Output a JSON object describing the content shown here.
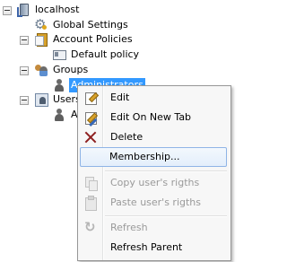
{
  "tree": {
    "root": "localhost",
    "global_settings": "Global Settings",
    "account_policies": "Account Policies",
    "default_policy": "Default policy",
    "groups": "Groups",
    "administrators": "Administrators",
    "users_partial": "Users",
    "user_child_partial": "A"
  },
  "context_menu": {
    "edit": "Edit",
    "edit_new_tab": "Edit On New Tab",
    "delete": "Delete",
    "membership": "Membership...",
    "copy_rights": "Copy user's rigths",
    "paste_rights": "Paste user's rigths",
    "refresh": "Refresh",
    "refresh_parent": "Refresh Parent"
  },
  "colors": {
    "selection": "#3399ff",
    "menu_background": "#f7f7f7",
    "hover_border": "#8fb4e6",
    "disabled_text": "#9a9a9a"
  }
}
